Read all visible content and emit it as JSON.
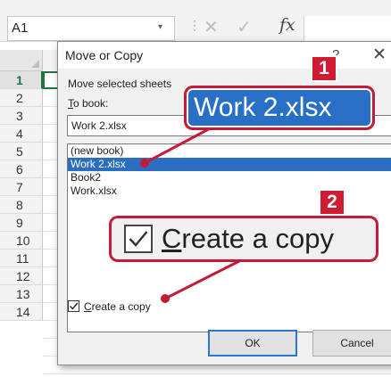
{
  "excel": {
    "name_box": "A1",
    "name_box_arrow": "▾",
    "fb_dots": "⋮",
    "fb_cancel": "✕",
    "fb_enter": "✓",
    "fb_fx": "fx",
    "rows": [
      "1",
      "2",
      "3",
      "4",
      "5",
      "6",
      "7",
      "8",
      "9",
      "10",
      "11",
      "12",
      "13",
      "14"
    ],
    "active_row": "1"
  },
  "dialog": {
    "title": "Move or Copy",
    "help": "?",
    "close": "✕",
    "move_label": "Move selected sheets",
    "to_book_accel": "T",
    "to_book_rest": "o book:",
    "to_book_value": "Work 2.xlsx",
    "sheet_list": [
      "(new book)",
      "Work 2.xlsx",
      "Book2",
      "Work.xlsx"
    ],
    "selected_index": 1,
    "create_copy_checked": true,
    "create_copy_accel": "C",
    "create_copy_rest": "reate a copy",
    "ok_label": "OK",
    "cancel_label": "Cancel"
  },
  "callouts": {
    "badge_1": "1",
    "badge_2": "2",
    "book_zoom_text": "Work 2.xlsx",
    "copy_zoom_accel": "C",
    "copy_zoom_rest": "reate a copy",
    "accent_red": "#c41b38",
    "accent_blue": "#2870c5"
  },
  "colors": {
    "excel_green": "#217346",
    "selection_blue": "#2b6ebf",
    "ok_border": "#2a77d3"
  }
}
